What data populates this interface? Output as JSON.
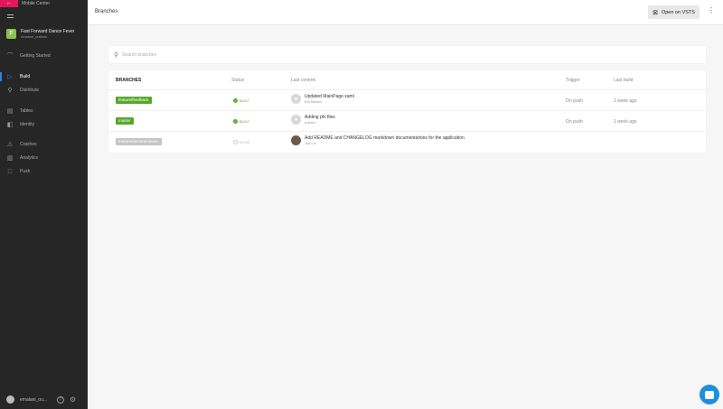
{
  "sidebar": {
    "brand": "Mobile Center",
    "app": {
      "initial": "F",
      "name": "Fast Forward Dance Fever",
      "owner": "emalani_outlook"
    },
    "nav": [
      {
        "label": "Getting Started",
        "icon": "rocket-icon",
        "glyph": "⌒"
      },
      {
        "label": "Build",
        "icon": "play-icon",
        "glyph": "▷"
      },
      {
        "label": "Distribute",
        "icon": "distribute-icon",
        "glyph": "⚲"
      },
      {
        "label": "Tables",
        "icon": "tables-icon",
        "glyph": "▤"
      },
      {
        "label": "Identity",
        "icon": "identity-icon",
        "glyph": "◧"
      },
      {
        "label": "Crashes",
        "icon": "warning-icon",
        "glyph": "⚠"
      },
      {
        "label": "Analytics",
        "icon": "analytics-icon",
        "glyph": "▥"
      },
      {
        "label": "Push",
        "icon": "push-icon",
        "glyph": "□"
      }
    ],
    "user": {
      "name": "emalani_ou...",
      "help": "?",
      "settings": "⚙"
    }
  },
  "header": {
    "title": "Branches",
    "vsts_label": "Open on VSTS",
    "more": "⋮"
  },
  "search": {
    "placeholder": "Search branches"
  },
  "table": {
    "columns": {
      "branches": "BRANCHES",
      "status": "Status",
      "last_commit": "Last commit",
      "trigger": "Trigger",
      "last_build": "Last build"
    },
    "rows": [
      {
        "branch": "feature/feedback",
        "badge_color": "#57a82a",
        "status": "BUILT",
        "commit_msg": "Updated MainPage.xaml",
        "commit_author": "Ela Malani",
        "trigger": "On push",
        "last_build": "1 week ago"
      },
      {
        "branch": "master",
        "badge_color": "#57a82a",
        "status": "BUILT",
        "commit_msg": "Adding pfx files",
        "commit_author": "malani",
        "trigger": "On push",
        "last_build": "1 week ago"
      },
      {
        "branch": "feature/documentation",
        "badge_color": "#c4c4c4",
        "status": "NONE",
        "commit_msg": "Add README and CHANGELOG markdown documentations for the application",
        "commit_author": "Joe Lin",
        "trigger": "",
        "last_build": ""
      }
    ]
  },
  "colors": {
    "accent": "#e4175c",
    "active": "#2f84d9",
    "success": "#57a82a",
    "chat": "#1e8fde"
  }
}
